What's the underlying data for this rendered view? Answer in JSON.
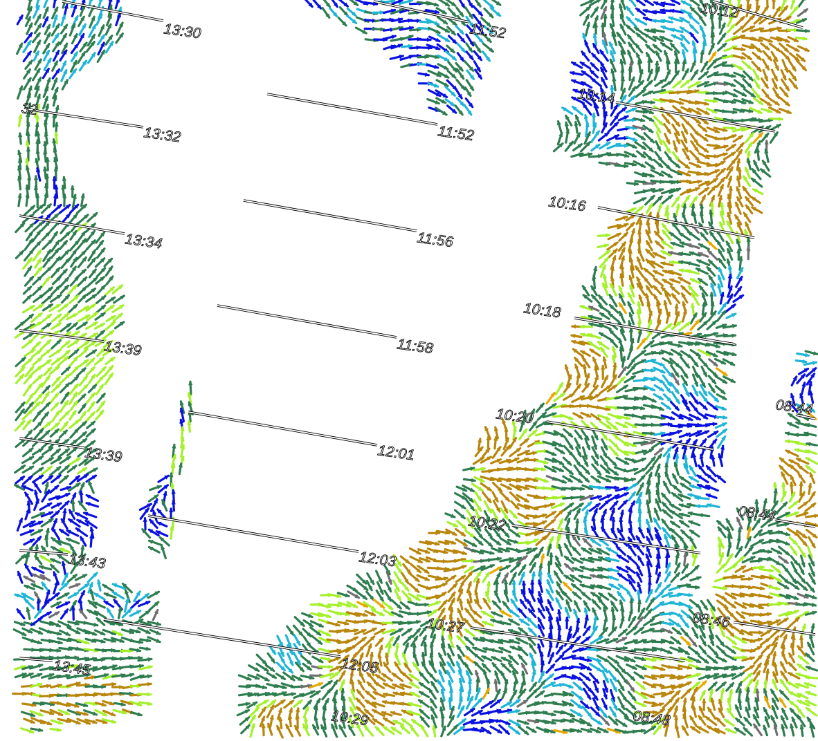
{
  "figure": {
    "description_free": true,
    "arrow_palette": {
      "blue": "#0a10e0",
      "dark_green": "#2e7d4f",
      "light_green": "#a4f02a",
      "cyan": "#1fb5d6",
      "brown": "#b8860b",
      "orange": "#e8a800",
      "gray": "#6f6f6f"
    }
  },
  "swaths": [
    {
      "id": "swath-1",
      "labels": [
        "13:30",
        "32",
        "13:32",
        "13:34",
        "13:39",
        "13:39",
        "13:43",
        "13:45"
      ]
    },
    {
      "id": "swath-2",
      "labels": [
        "11:52",
        "11:52",
        "11:56",
        "11:58",
        "12:01",
        "12:03",
        "12:05"
      ]
    },
    {
      "id": "swath-3",
      "labels": [
        "10:12",
        "10:14",
        "10:16",
        "10:18",
        "10:20",
        "10:22",
        "10:27",
        "10:29"
      ]
    },
    {
      "id": "swath-4",
      "labels": [
        "08:44",
        "08:44",
        "08:46",
        "08:48"
      ]
    }
  ]
}
